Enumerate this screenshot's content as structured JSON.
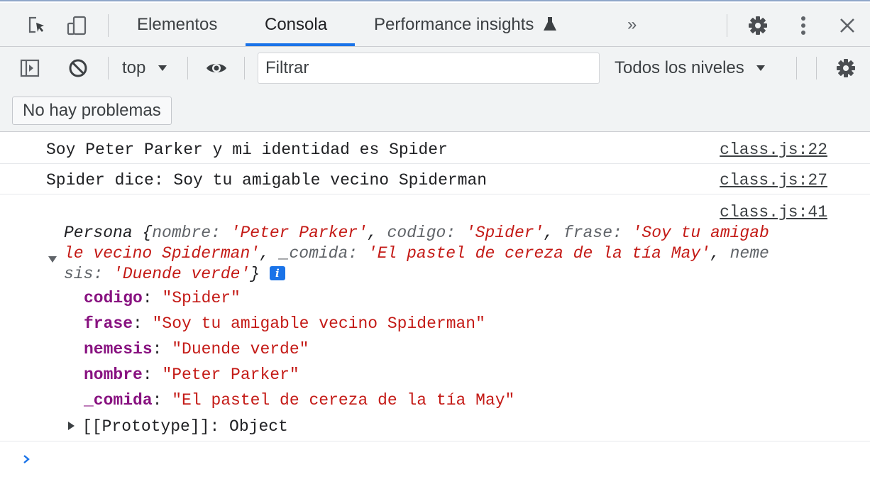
{
  "tabs": {
    "elements": "Elementos",
    "console": "Consola",
    "performance": "Performance insights",
    "more": "»"
  },
  "toolbar": {
    "context": "top",
    "filter_placeholder": "Filtrar",
    "levels": "Todos los niveles",
    "problems": "No hay problemas"
  },
  "console": {
    "messages": [
      {
        "text": "Soy Peter Parker y mi identidad es Spider",
        "source": "class.js:22"
      },
      {
        "text": "Spider dice: Soy tu amigable vecino Spiderman",
        "source": "class.js:27"
      }
    ],
    "object_log": {
      "source": "class.js:41",
      "preview": {
        "class_name": "Persona",
        "k1": "nombre",
        "v1": "'Peter Parker'",
        "k2": "codigo",
        "v2": "'Spider'",
        "k3": "frase",
        "v3a": "'Soy tu amigab",
        "v3b": "le vecino Spiderman'",
        "k4": "_comida",
        "v4": "'El pastel de cereza de la tía May'",
        "k5a": "neme",
        "k5b": "sis",
        "v5": "'Duende verde'"
      },
      "properties": [
        {
          "key": "codigo",
          "value": "\"Spider\""
        },
        {
          "key": "frase",
          "value": "\"Soy tu amigable vecino Spiderman\""
        },
        {
          "key": "nemesis",
          "value": "\"Duende verde\""
        },
        {
          "key": "nombre",
          "value": "\"Peter Parker\""
        },
        {
          "key": "_comida",
          "value": "\"El pastel de cereza de la tía May\""
        }
      ],
      "prototype_key": "[[Prototype]]",
      "prototype_value": "Object"
    }
  },
  "colors": {
    "accent": "#1a73e8",
    "string": "#c41a16",
    "property": "#881280"
  },
  "icons": [
    "inspect-icon",
    "device-toggle-icon",
    "flask-icon",
    "gear-icon",
    "kebab-menu-icon",
    "close-icon",
    "sidebar-toggle-icon",
    "clear-console-icon",
    "dropdown-arrow-icon",
    "eye-icon",
    "info-icon",
    "expand-triangle-icon",
    "prompt-chevron-icon"
  ]
}
